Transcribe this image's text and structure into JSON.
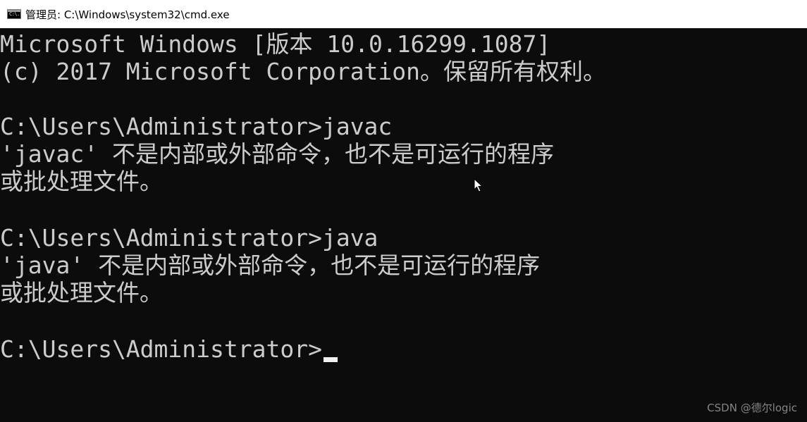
{
  "window": {
    "title": "管理员: C:\\Windows\\system32\\cmd.exe",
    "icon_name": "cmd-icon",
    "icon_glyph": "C:\\."
  },
  "console": {
    "lines": [
      "Microsoft Windows [版本 10.0.16299.1087]",
      "(c) 2017 Microsoft Corporation。保留所有权利。",
      "",
      "C:\\Users\\Administrator>javac",
      "'javac' 不是内部或外部命令，也不是可运行的程序",
      "或批处理文件。",
      "",
      "C:\\Users\\Administrator>java",
      "'java' 不是内部或外部命令，也不是可运行的程序",
      "或批处理文件。",
      "",
      "C:\\Users\\Administrator>"
    ],
    "text_color": "#cccccc",
    "background_color": "#0c0c0c"
  },
  "watermark": {
    "text": "CSDN @德尔logic"
  }
}
